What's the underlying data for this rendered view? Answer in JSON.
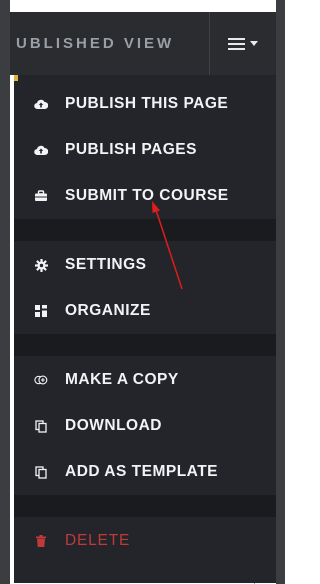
{
  "header": {
    "view_title": "UBLISHED VIEW",
    "menu_icon": "hamburger-icon",
    "caret_icon": "caret-down-icon"
  },
  "menu": {
    "items": [
      {
        "label": "PUBLISH THIS PAGE",
        "icon": "cloud-upload-icon"
      },
      {
        "label": "PUBLISH PAGES",
        "icon": "cloud-upload-icon"
      },
      {
        "label": "SUBMIT TO COURSE",
        "icon": "briefcase-icon"
      },
      {
        "label": "SETTINGS",
        "icon": "gear-icon"
      },
      {
        "label": "ORGANIZE",
        "icon": "grid-icon"
      },
      {
        "label": "MAKE A COPY",
        "icon": "copy-circle-icon"
      },
      {
        "label": "DOWNLOAD",
        "icon": "document-copy-icon"
      },
      {
        "label": "ADD AS TEMPLATE",
        "icon": "document-copy-icon"
      },
      {
        "label": "DELETE",
        "icon": "trash-icon"
      }
    ]
  },
  "colors": {
    "accent": "#e2b33a",
    "menu_bg": "#23252a",
    "danger": "#c03a3a",
    "annotation_arrow": "#e01c1c"
  }
}
